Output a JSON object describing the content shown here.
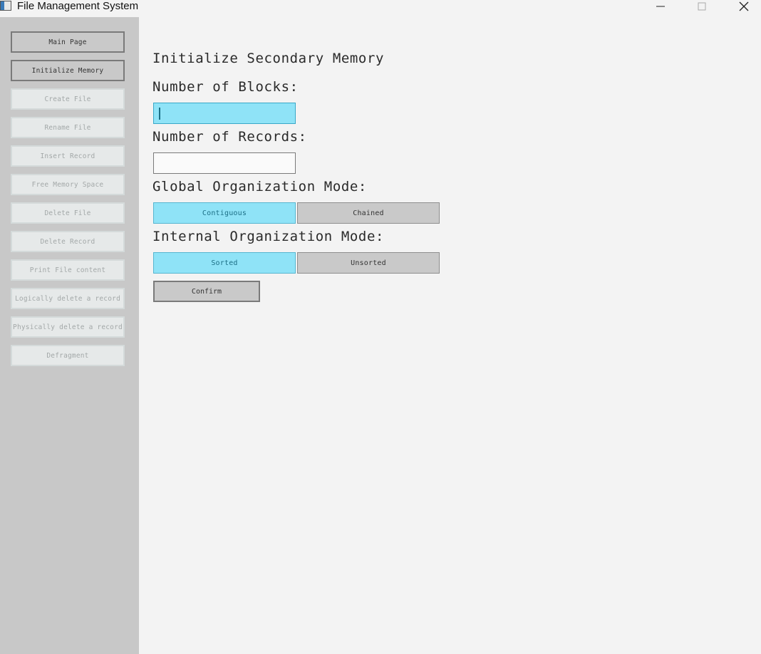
{
  "window": {
    "title": "File Management System",
    "controls": [
      "minimize-icon",
      "maximize-icon",
      "close-icon"
    ]
  },
  "sidebar": {
    "items": [
      {
        "label": "Main Page",
        "enabled": true
      },
      {
        "label": "Initialize Memory",
        "enabled": true
      },
      {
        "label": "Create File",
        "enabled": false
      },
      {
        "label": "Rename File",
        "enabled": false
      },
      {
        "label": "Insert Record",
        "enabled": false
      },
      {
        "label": "Free Memory Space",
        "enabled": false
      },
      {
        "label": "Delete File",
        "enabled": false
      },
      {
        "label": "Delete Record",
        "enabled": false
      },
      {
        "label": "Print File content",
        "enabled": false
      },
      {
        "label": "Logically delete a record",
        "enabled": false
      },
      {
        "label": "Physically delete a record",
        "enabled": false
      },
      {
        "label": "Defragment",
        "enabled": false
      }
    ]
  },
  "main": {
    "title": "Initialize Secondary Memory",
    "blocks": {
      "label": "Number of Blocks:",
      "value": ""
    },
    "records": {
      "label": "Number of Records:",
      "value": ""
    },
    "global_mode": {
      "label": "Global Organization Mode:",
      "options": [
        "Contiguous",
        "Chained"
      ],
      "selected": "Contiguous"
    },
    "internal_mode": {
      "label": "Internal Organization Mode:",
      "options": [
        "Sorted",
        "Unsorted"
      ],
      "selected": "Sorted"
    },
    "confirm_label": "Confirm"
  },
  "colors": {
    "accent": "#8fe3f7",
    "sidebar_bg": "#c8c8c8",
    "content_bg": "#f3f3f3",
    "button_bg": "#c9c9c9"
  }
}
